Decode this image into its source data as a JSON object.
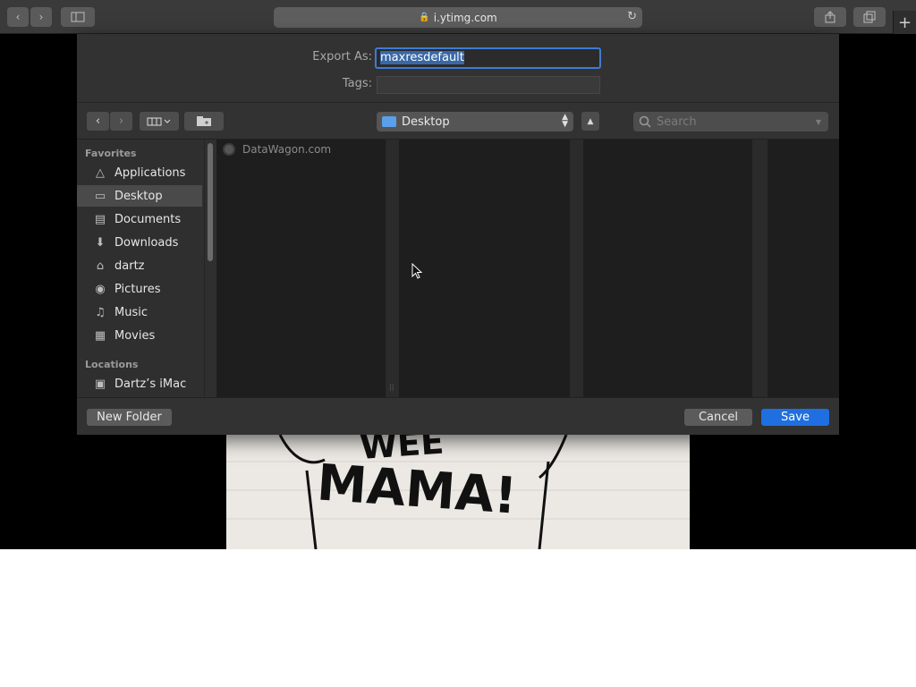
{
  "browser": {
    "url": "i.ytimg.com",
    "new_tab": "+"
  },
  "dialog": {
    "export_label": "Export As:",
    "export_value": "maxresdefault",
    "tags_label": "Tags:",
    "tags_value": "",
    "location": "Desktop",
    "search_placeholder": "Search",
    "sidebar": {
      "favorites_header": "Favorites",
      "favorites": [
        {
          "label": "Applications",
          "icon": "applications-icon"
        },
        {
          "label": "Desktop",
          "icon": "desktop-icon",
          "selected": true
        },
        {
          "label": "Documents",
          "icon": "documents-icon"
        },
        {
          "label": "Downloads",
          "icon": "downloads-icon"
        },
        {
          "label": "dartz",
          "icon": "home-icon"
        },
        {
          "label": "Pictures",
          "icon": "pictures-icon"
        },
        {
          "label": "Music",
          "icon": "music-icon"
        },
        {
          "label": "Movies",
          "icon": "movies-icon"
        }
      ],
      "locations_header": "Locations",
      "locations": [
        {
          "label": "Dartz’s iMac",
          "icon": "imac-icon"
        }
      ]
    },
    "files": [
      {
        "name": "DataWagon.com"
      }
    ],
    "new_folder_label": "New Folder",
    "cancel_label": "Cancel",
    "save_label": "Save"
  },
  "background_art": {
    "text_line1": "WEE",
    "text_line2": "MAMA!"
  },
  "colors": {
    "accent": "#1f6fe0",
    "focus_ring": "#3e7bd4",
    "sheet_bg": "#323232"
  }
}
